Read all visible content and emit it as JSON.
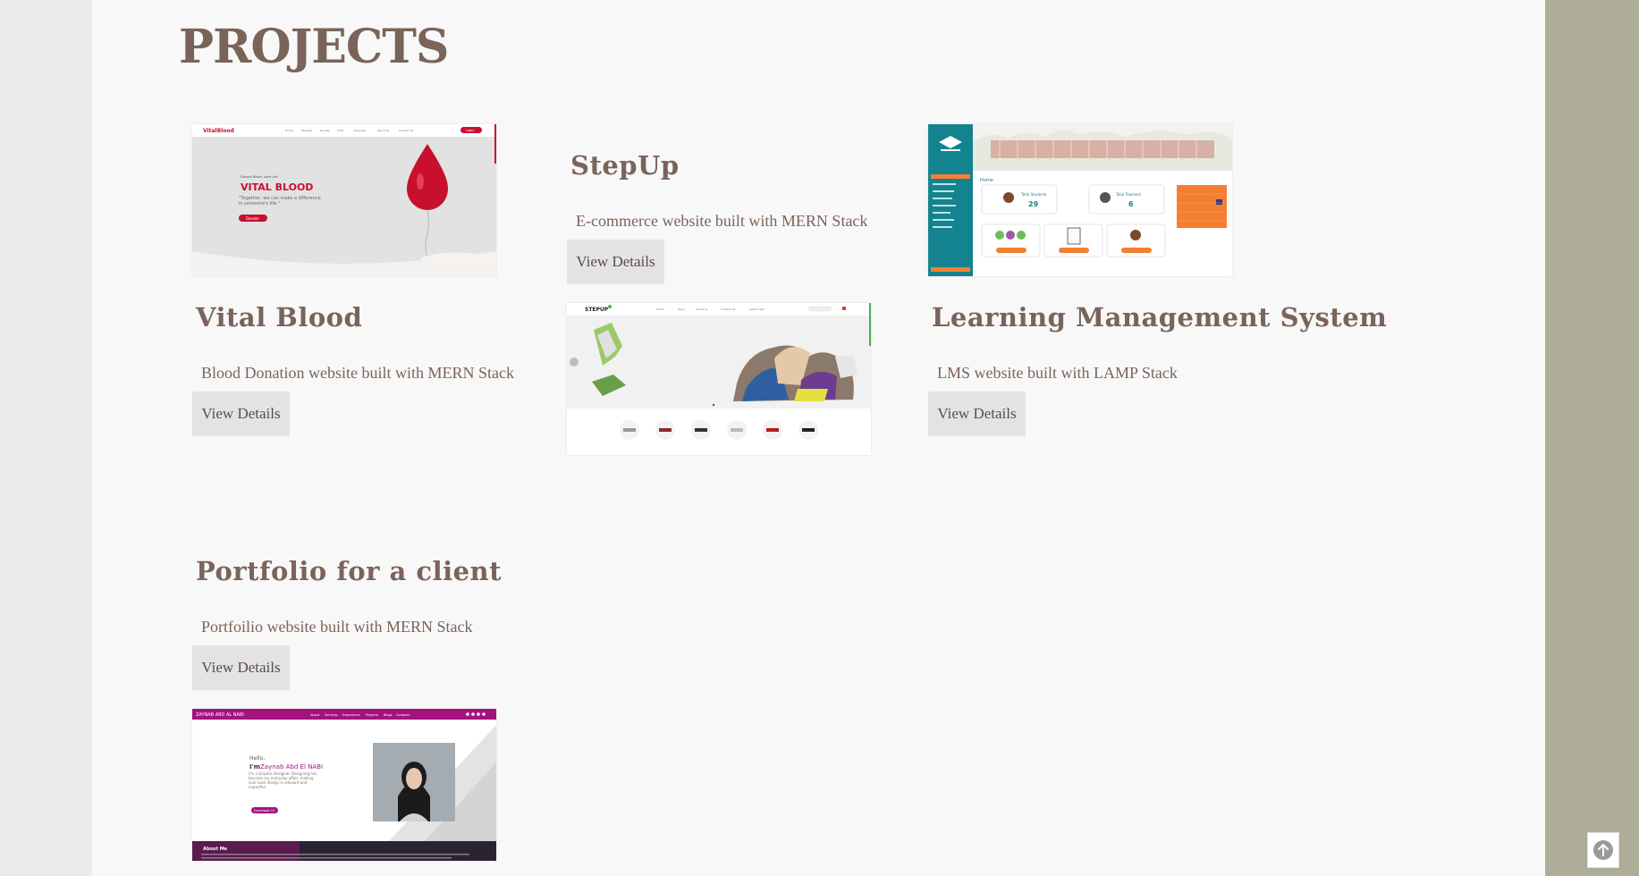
{
  "section_heading": "PROJECTS",
  "projects": [
    {
      "title": "Vital Blood",
      "description": "Blood Donation website built with MERN Stack",
      "button": "View Details",
      "preview": {
        "logo": "VitalBlood",
        "nav": [
          "Home",
          "Request",
          "Donate",
          "Chat",
          "Volunteer",
          "About Us",
          "Contact Us"
        ],
        "login": "Login",
        "tagline": "Donate Blood, save Life",
        "headline": "VITAL BLOOD",
        "quote": "\"Together, we can make a difference in someone's life.\"",
        "cta": "Donate"
      }
    },
    {
      "title": "StepUp",
      "description": "E-commerce website built with MERN Stack",
      "button": "View Details",
      "preview": {
        "logo": "STEPUP",
        "nav": [
          "Home",
          "Shop",
          "About Us",
          "Contact Us",
          "Admin Hub"
        ]
      }
    },
    {
      "title": "Learning Management System",
      "description": "LMS website built with LAMP Stack",
      "button": "View Details",
      "preview": {
        "section_label": "Home",
        "stat_students_label": "Total Students",
        "stat_students_value": "29",
        "stat_teachers_label": "Total Teachers",
        "stat_teachers_value": "6"
      }
    },
    {
      "title": "Portfolio for a client",
      "description": "Portfoilio website built with MERN Stack",
      "button": "View Details",
      "preview": {
        "brand": "ZAYNAB ABD AL NABI",
        "nav": [
          "About",
          "Services",
          "Experience",
          "Projects",
          "Blogs",
          "Contacts"
        ],
        "greeting": "Hello,",
        "intro_prefix": "I'm",
        "intro_name": "Zaynab Abd El NABI",
        "bio": "I'm a Graphic Designer. Designing has become my everyday affair, making sure each design is relevant and impactful.",
        "cta": "Download CV",
        "about": "About Me"
      }
    }
  ],
  "scroll_top_icon": "arrow-up-circle-icon",
  "colors": {
    "heading": "#7a645a",
    "page_bg": "#f8f8f8",
    "rail": "#aeae98",
    "button_bg": "#e3e3e3",
    "vital_red": "#c8102e",
    "lms_teal": "#13838f",
    "lms_orange": "#f47f32",
    "portfolio_magenta": "#a3127f"
  }
}
